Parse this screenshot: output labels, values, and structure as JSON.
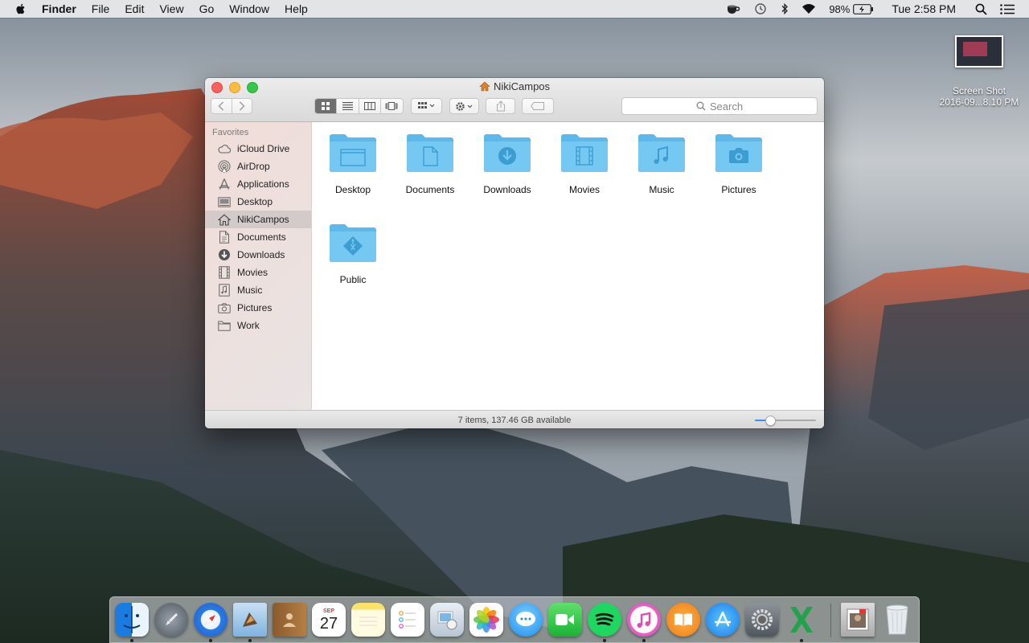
{
  "menubar": {
    "app_name": "Finder",
    "menus": [
      "File",
      "Edit",
      "View",
      "Go",
      "Window",
      "Help"
    ],
    "battery": "98%",
    "clock": "Tue 2:58 PM"
  },
  "desktop": {
    "icon_label_line1": "Screen Shot",
    "icon_label_line2": "2016-09...8.10 PM"
  },
  "window": {
    "title": "NikiCampos",
    "search_placeholder": "Search",
    "sidebar": {
      "section": "Favorites",
      "items": [
        {
          "label": "iCloud Drive",
          "icon": "cloud-icon"
        },
        {
          "label": "AirDrop",
          "icon": "airdrop-icon"
        },
        {
          "label": "Applications",
          "icon": "applications-icon"
        },
        {
          "label": "Desktop",
          "icon": "desktop-icon"
        },
        {
          "label": "NikiCampos",
          "icon": "home-icon",
          "selected": true
        },
        {
          "label": "Documents",
          "icon": "document-icon"
        },
        {
          "label": "Downloads",
          "icon": "download-icon"
        },
        {
          "label": "Movies",
          "icon": "film-icon"
        },
        {
          "label": "Music",
          "icon": "music-icon"
        },
        {
          "label": "Pictures",
          "icon": "camera-icon"
        },
        {
          "label": "Work",
          "icon": "folder-icon"
        }
      ]
    },
    "folders": [
      {
        "label": "Desktop",
        "icon": "desktop-folder-icon"
      },
      {
        "label": "Documents",
        "icon": "documents-folder-icon"
      },
      {
        "label": "Downloads",
        "icon": "downloads-folder-icon"
      },
      {
        "label": "Movies",
        "icon": "movies-folder-icon"
      },
      {
        "label": "Music",
        "icon": "music-folder-icon"
      },
      {
        "label": "Pictures",
        "icon": "pictures-folder-icon"
      },
      {
        "label": "Public",
        "icon": "public-folder-icon"
      }
    ],
    "status": "7 items, 137.46 GB available",
    "icon_size_level": 0.25,
    "folder_color": "#67c4f0"
  },
  "dock": {
    "calendar_month": "SEP",
    "calendar_day": "27",
    "apps": [
      "Finder",
      "Launchpad",
      "Safari",
      "Mail",
      "Contacts",
      "Calendar",
      "Notes",
      "Reminders",
      "Preview",
      "Photos",
      "Messages",
      "FaceTime",
      "Spotify",
      "iTunes",
      "iBooks",
      "App Store",
      "System Preferences",
      "Excel",
      "Screen Shot",
      "Trash"
    ]
  }
}
